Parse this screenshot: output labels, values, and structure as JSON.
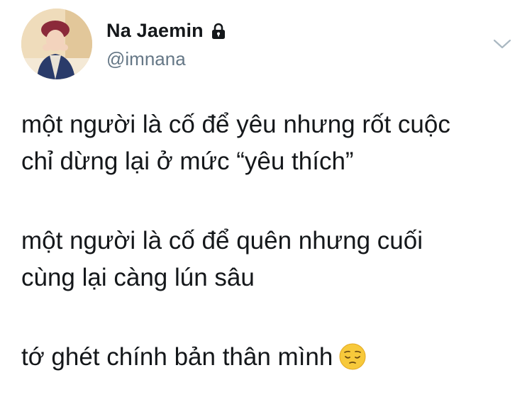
{
  "user": {
    "display_name": "Na Jaemin",
    "handle": "@imnana",
    "protected_icon": "lock-icon",
    "avatar_icon": "profile-photo"
  },
  "tweet": {
    "paragraphs": [
      [
        "một người là cố để yêu nhưng rốt cuộc",
        "chỉ dừng lại ở mức “yêu thích”"
      ],
      [
        "một người là cố để quên nhưng cuối",
        "cùng lại càng lún sâu"
      ],
      [
        "tớ ghét chính bản thân mình"
      ]
    ],
    "emoji": "pensive-face"
  },
  "menu": {
    "caret_icon": "chevron-down-icon",
    "caret_color": "#aab8c2"
  },
  "colors": {
    "text": "#14171a",
    "secondary": "#657786",
    "background": "#ffffff"
  }
}
